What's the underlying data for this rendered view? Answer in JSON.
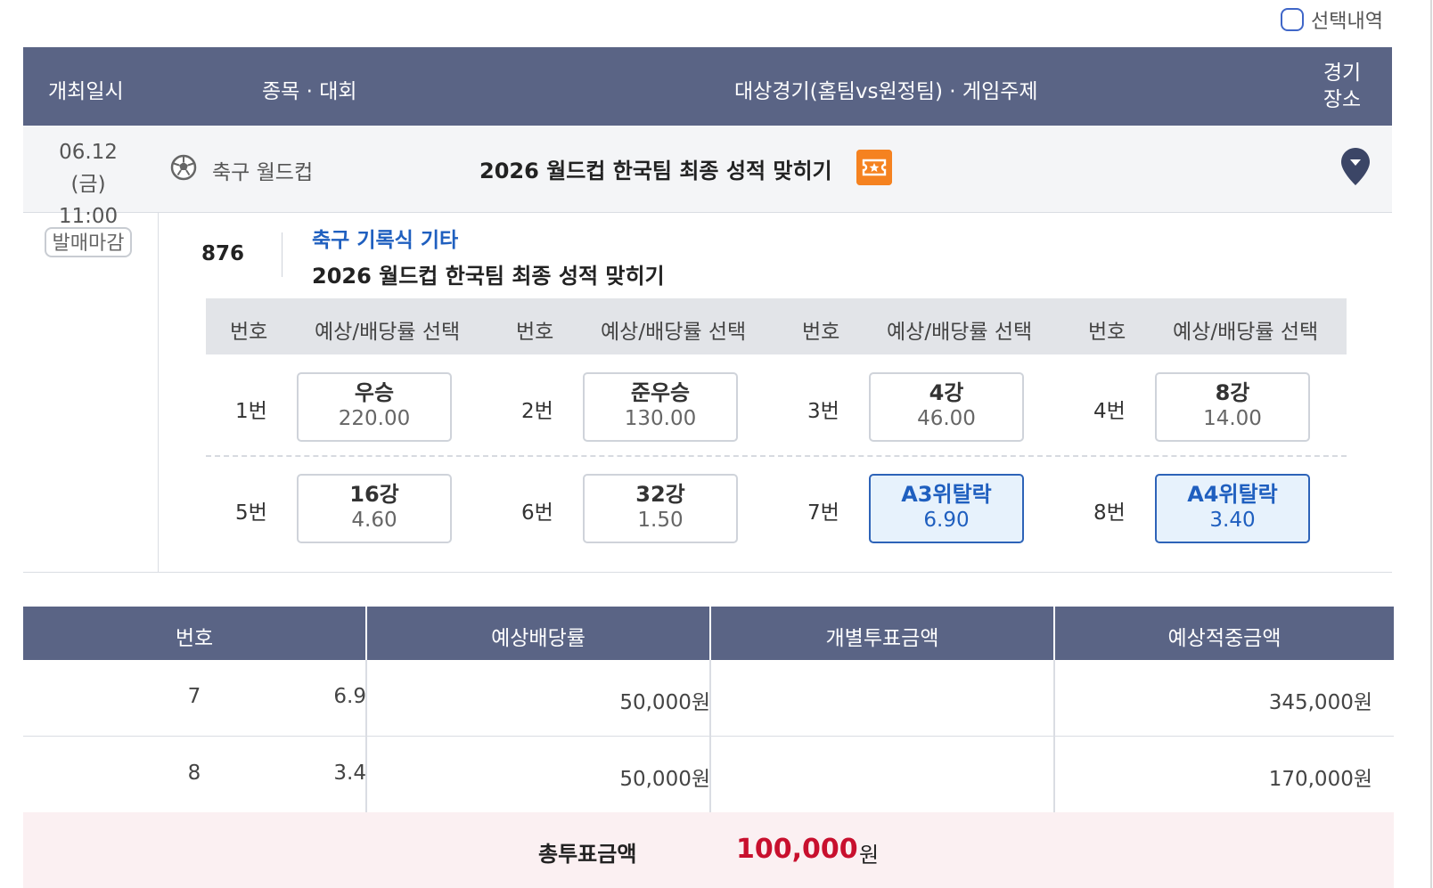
{
  "toggle": {
    "label": "선택내역"
  },
  "header": {
    "date": "개최일시",
    "sport": "종목 · 대회",
    "game": "대상경기(홈팀vs원정팀) · 게임주제",
    "venue_line1": "경기",
    "venue_line2": "장소"
  },
  "match": {
    "date": "06.12 (금)",
    "time": "11:00",
    "sport": "축구 월드컵",
    "title": "2026 월드컵 한국팀 최종 성적 맞히기",
    "status": "발매마감"
  },
  "game": {
    "number": "876",
    "category": "축구 기록식 기타",
    "title": "2026 월드컵 한국팀 최종 성적 맞히기"
  },
  "options_header": {
    "num": "번호",
    "pick": "예상/배당률 선택"
  },
  "options": [
    {
      "label": "1번",
      "name": "우승",
      "odds": "220.00",
      "selected": false
    },
    {
      "label": "2번",
      "name": "준우승",
      "odds": "130.00",
      "selected": false
    },
    {
      "label": "3번",
      "name": "4강",
      "odds": "46.00",
      "selected": false
    },
    {
      "label": "4번",
      "name": "8강",
      "odds": "14.00",
      "selected": false
    },
    {
      "label": "5번",
      "name": "16강",
      "odds": "4.60",
      "selected": false
    },
    {
      "label": "6번",
      "name": "32강",
      "odds": "1.50",
      "selected": false
    },
    {
      "label": "7번",
      "name": "A3위탈락",
      "odds": "6.90",
      "selected": true
    },
    {
      "label": "8번",
      "name": "A4위탈락",
      "odds": "3.40",
      "selected": true
    }
  ],
  "summary": {
    "headers": [
      "번호",
      "예상배당률",
      "개별투표금액",
      "예상적중금액"
    ],
    "rows": [
      [
        "7",
        "6.9",
        "50,000원",
        "345,000원"
      ],
      [
        "8",
        "3.4",
        "50,000원",
        "170,000원"
      ]
    ],
    "total_label": "총투표금액",
    "total_amount": "100,000",
    "total_unit": "원"
  },
  "colors": {
    "header_bg": "#5a6485",
    "accent_blue": "#1f5fbf",
    "selected_bg": "#e7f2fc",
    "ticket_orange": "#f58220",
    "total_red": "#c8102e",
    "total_bg": "#fbf0f2"
  }
}
